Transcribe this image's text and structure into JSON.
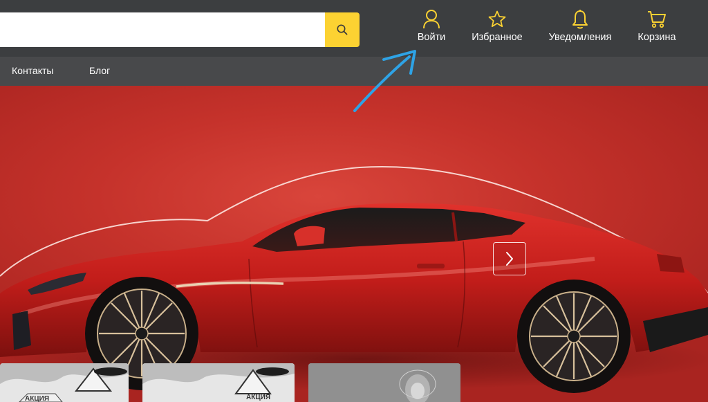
{
  "search": {
    "value": "",
    "placeholder": ""
  },
  "header_actions": [
    {
      "id": "login",
      "label": "Войти",
      "icon": "user-icon"
    },
    {
      "id": "favorites",
      "label": "Избранное",
      "icon": "star-icon"
    },
    {
      "id": "notifications",
      "label": "Уведомления",
      "icon": "bell-icon"
    },
    {
      "id": "cart",
      "label": "Корзина",
      "icon": "cart-icon"
    }
  ],
  "subnav": [
    {
      "label": "Контакты"
    },
    {
      "label": "Блог"
    }
  ],
  "promo_cards": [
    {
      "badge": "АКЦИЯ"
    },
    {
      "badge": "АКЦИЯ"
    }
  ],
  "colors": {
    "accent": "#fcd232",
    "header_bg": "#3c3e40",
    "subnav_bg": "#48494b",
    "hero_red": "#c5322b",
    "annotation_arrow": "#2ea3e6"
  }
}
